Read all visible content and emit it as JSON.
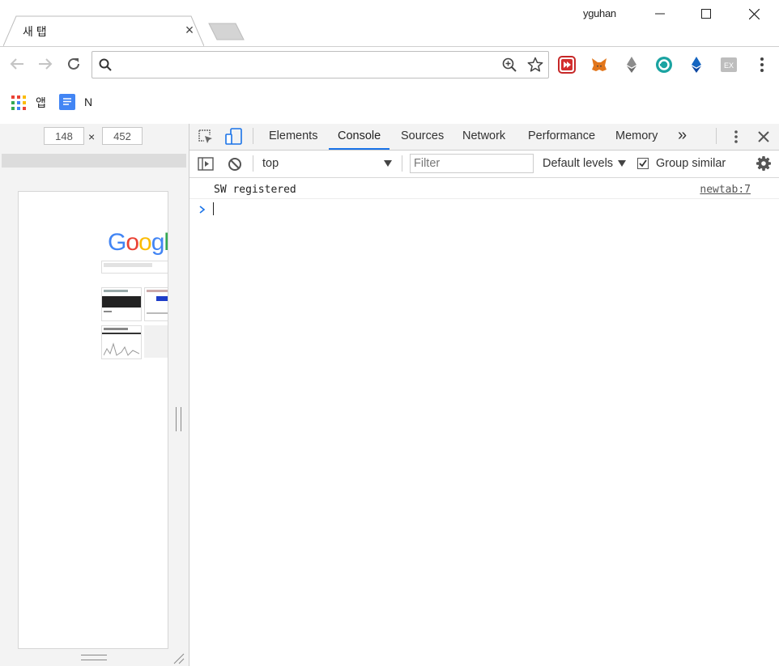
{
  "window": {
    "user_name": "yguhan",
    "tab_title": "새 탭"
  },
  "toolbar": {
    "omnibox_value": "",
    "extensions": [
      "youtube-extension-icon",
      "metamask-icon",
      "ethereum-icon",
      "circular-extension-icon",
      "ethereum-blue-icon",
      "ex-extension-icon"
    ]
  },
  "bookmarks": {
    "apps_label": "앱",
    "doc_label": "N"
  },
  "device": {
    "width": "148",
    "separator": "×",
    "height": "452"
  },
  "devtools": {
    "tabs": [
      "Elements",
      "Console",
      "Sources",
      "Network",
      "Performance",
      "Memory"
    ],
    "active_tab": "Console",
    "more_tabs": "»",
    "context": "top",
    "filter_placeholder": "Filter",
    "levels": "Default levels",
    "group_similar": "Group similar",
    "group_similar_checked": true
  },
  "console": {
    "messages": [
      {
        "text": "SW registered",
        "source": "newtab:7"
      }
    ]
  },
  "colors": {
    "accent": "#1a73e8",
    "google_blue": "#4285f4",
    "google_red": "#ea4335",
    "google_yellow": "#fbbc05",
    "google_green": "#34a853"
  }
}
